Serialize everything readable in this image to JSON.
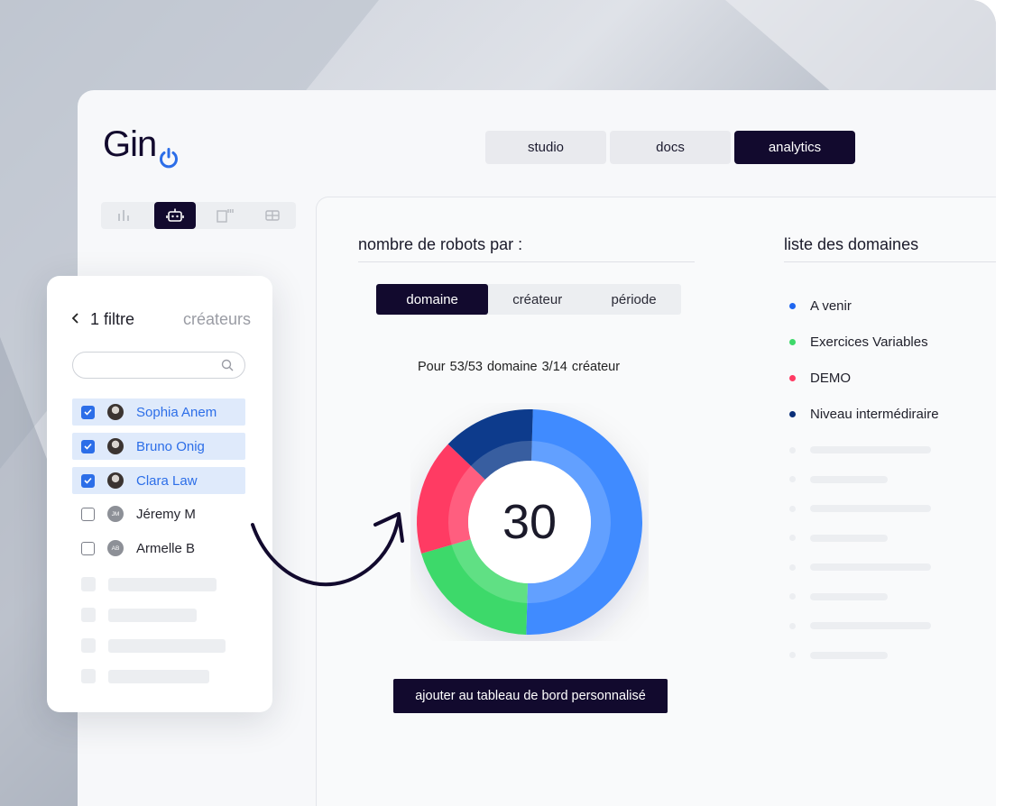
{
  "brand": {
    "name": "Gin",
    "logo_icon": "power-icon",
    "logo_accent": "#2c6ee8"
  },
  "topnav": {
    "tabs": [
      {
        "label": "studio",
        "active": false
      },
      {
        "label": "docs",
        "active": false
      },
      {
        "label": "analytics",
        "active": true
      }
    ]
  },
  "sidetabs": {
    "icons": [
      "bar-chart-icon",
      "robot-icon",
      "document-icon",
      "table-icon"
    ],
    "active_index": 1
  },
  "chart_section": {
    "title": "nombre de robots par :",
    "segments": [
      {
        "label": "domaine",
        "active": true
      },
      {
        "label": "créateur",
        "active": false
      },
      {
        "label": "période",
        "active": false
      }
    ],
    "summary": "Pour  53/53 domaine  3/14 créateur",
    "cta_label": "ajouter au tableau de bord personnalisé"
  },
  "chart_data": {
    "type": "pie",
    "donut": true,
    "center_label": "30",
    "slices": [
      {
        "value": 15,
        "color": "#3f8bff"
      },
      {
        "value": 6,
        "color": "#3ed96a"
      },
      {
        "value": 5,
        "color": "#ff3a63"
      },
      {
        "value": 4,
        "color": "#0a3a8c"
      }
    ]
  },
  "domain_list": {
    "title": "liste des domaines",
    "items": [
      {
        "label": "A venir",
        "color": "#1f66f0"
      },
      {
        "label": "Exercices Variables",
        "color": "#3ed96a"
      },
      {
        "label": "DEMO",
        "color": "#ff3a63"
      },
      {
        "label": "Niveau intermédiraire",
        "color": "#0a2f78"
      }
    ]
  },
  "filter": {
    "back_icon": "chevron-left-icon",
    "count_label": "1 filtre",
    "category_label": "créateurs",
    "search_placeholder": "",
    "creators": [
      {
        "name": "Sophia Anem",
        "checked": true,
        "avatar": "photo"
      },
      {
        "name": "Bruno Onig",
        "checked": true,
        "avatar": "photo"
      },
      {
        "name": "Clara Law",
        "checked": true,
        "avatar": "photo"
      },
      {
        "name": "Jéremy M",
        "checked": false,
        "avatar": "JM"
      },
      {
        "name": "Armelle B",
        "checked": false,
        "avatar": "AB"
      }
    ]
  }
}
